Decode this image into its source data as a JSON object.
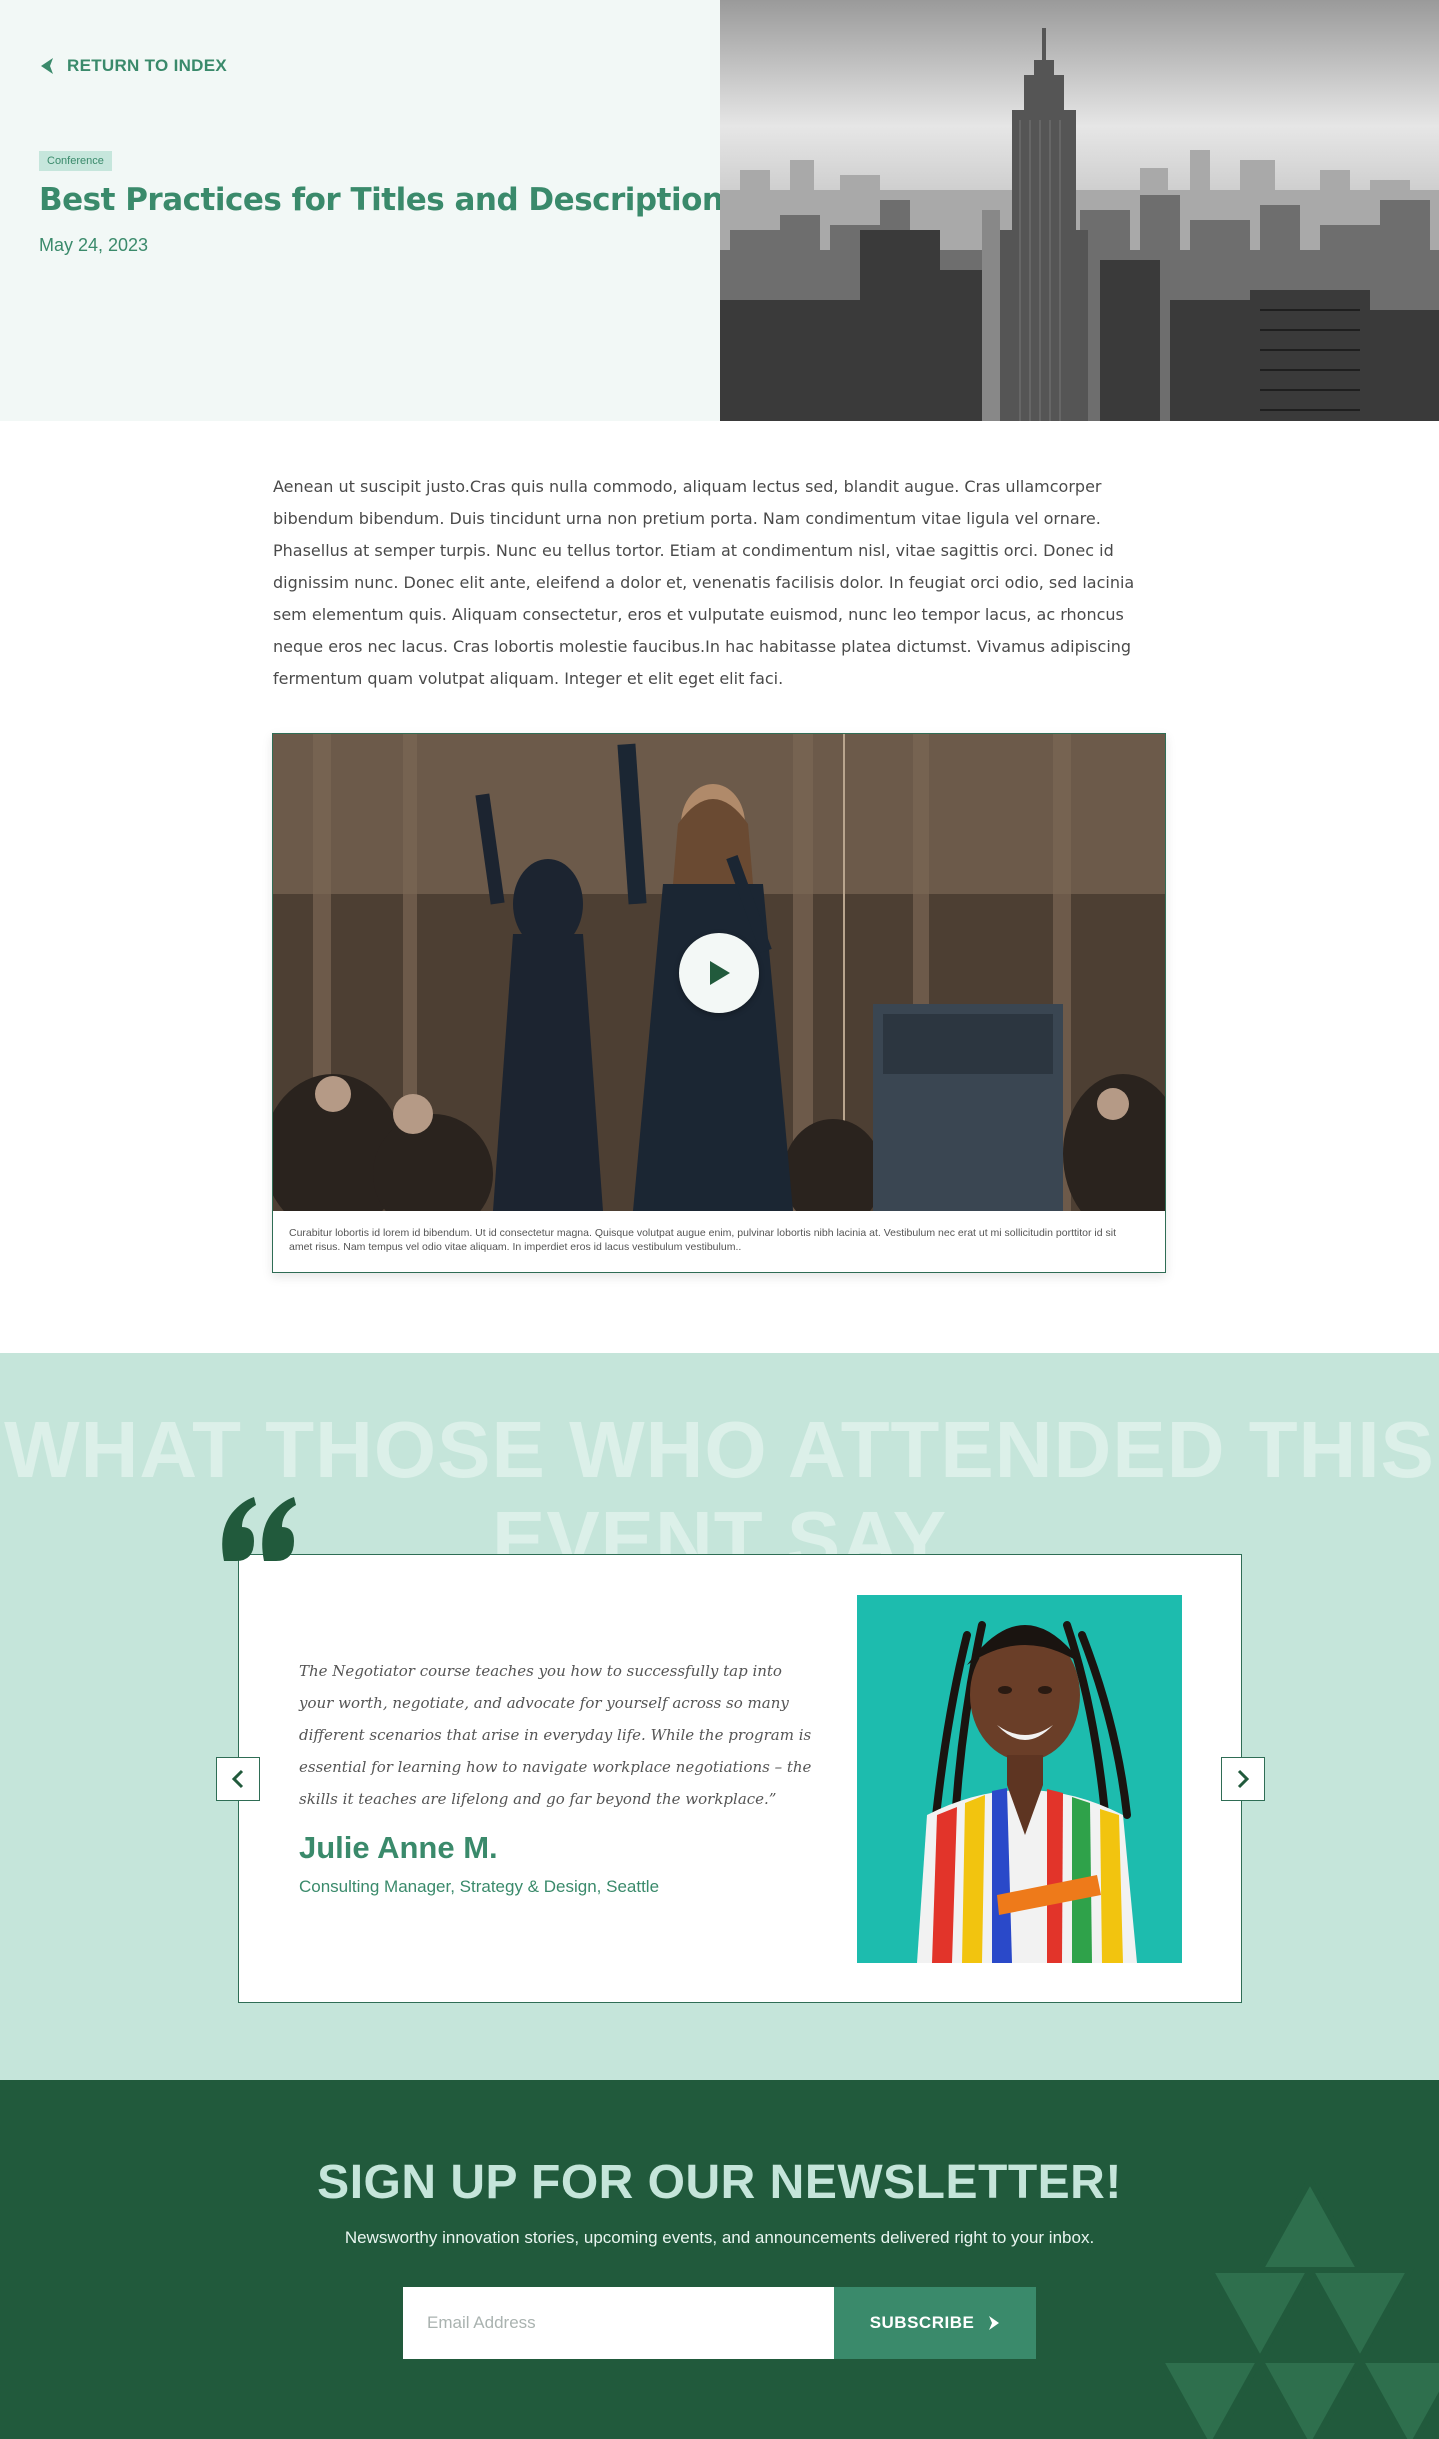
{
  "hero": {
    "back_label": "RETURN TO INDEX",
    "tag": "Conference",
    "title": "Best Practices for Titles and Descriptions",
    "date": "May 24, 2023"
  },
  "article": {
    "body": "Aenean ut suscipit justo.Cras quis nulla commodo, aliquam lectus sed, blandit augue. Cras ullamcorper bibendum bibendum. Duis tincidunt urna non pretium porta. Nam condimentum vitae ligula vel ornare. Phasellus at semper turpis. Nunc eu tellus tortor. Etiam at condimentum nisl, vitae sagittis orci. Donec id dignissim nunc. Donec elit ante, eleifend a dolor et, venenatis facilisis dolor. In feugiat orci odio, sed lacinia sem elementum quis. Aliquam consectetur, eros et vulputate euismod, nunc leo tempor lacus, ac rhoncus neque eros nec lacus. Cras lobortis molestie faucibus.In hac habitasse platea dictumst. Vivamus adipiscing fermentum quam volutpat aliquam. Integer et elit eget elit faci.",
    "video_caption": "Curabitur lobortis id lorem id bibendum. Ut id consectetur magna. Quisque volutpat augue enim, pulvinar lobortis nibh lacinia at. Vestibulum nec erat ut mi sollicitudin porttitor id sit amet risus. Nam tempus vel odio vitae aliquam. In imperdiet eros id lacus vestibulum vestibulum.."
  },
  "testimonials": {
    "heading": "WHAT THOSE WHO ATTENDED THIS EVENT SAY",
    "quote": "The Negotiator course teaches you how to successfully tap into your worth, negotiate, and advocate for yourself across so many different scenarios that arise in everyday life. While the program is essential for learning how to navigate workplace negotiations – the skills it teaches are lifelong and go far beyond the workplace.”",
    "name": "Julie Anne M.",
    "role": "Consulting Manager, Strategy & Design, Seattle"
  },
  "newsletter": {
    "title": "SIGN UP FOR OUR NEWSLETTER!",
    "subtitle": "Newsworthy innovation stories, upcoming events, and announcements delivered right to your inbox.",
    "email_placeholder": "Email Address",
    "button_label": "SUBSCRIBE"
  },
  "colors": {
    "brand_green": "#3a8a6b",
    "dark_green": "#215a3c",
    "mint": "#c5e5da",
    "hero_bg": "#f2f8f6"
  },
  "icons": [
    "back-arrow-icon",
    "play-icon",
    "quote-icon",
    "chevron-left-icon",
    "chevron-right-icon",
    "arrow-right-icon"
  ]
}
